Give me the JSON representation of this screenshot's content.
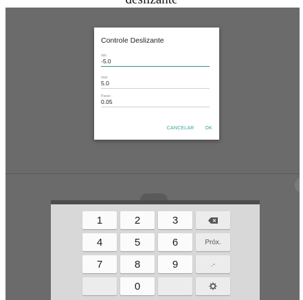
{
  "caption": "deslizante",
  "dialog": {
    "title": "Controle Deslizante",
    "fields": [
      {
        "label": "min",
        "value": "-5.0",
        "active": true
      },
      {
        "label": "max",
        "value": "5.0",
        "active": false
      },
      {
        "label": "Passo",
        "value": "0.05",
        "active": false
      }
    ],
    "cancel_label": "CANCELAR",
    "ok_label": "OK",
    "accent_color": "#35a39a"
  },
  "keyboard": {
    "keys": [
      "1",
      "2",
      "3",
      "4",
      "5",
      "6",
      "7",
      "8",
      "9",
      "0"
    ],
    "next_label": "Próx.",
    "dash_label": ".-",
    "backspace_icon": "backspace-icon",
    "settings_icon": "gear-icon"
  }
}
